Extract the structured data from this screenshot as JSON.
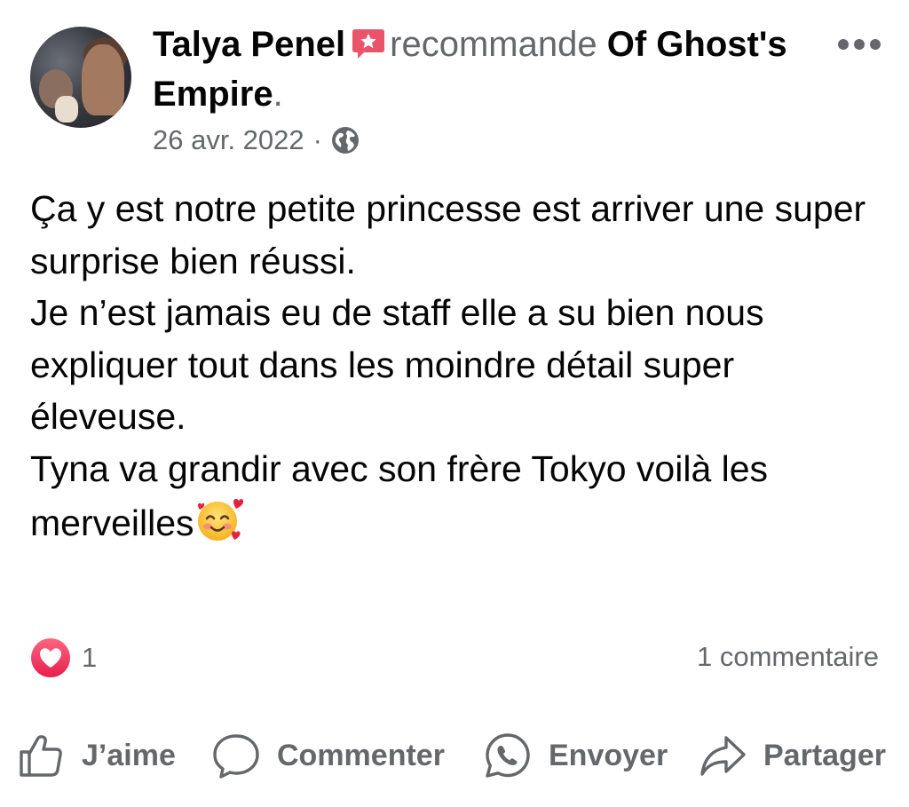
{
  "header": {
    "author": "Talya Penel",
    "verb": "recommande",
    "page": "Of Ghost's Empire",
    "punct": ".",
    "date": "26 avr. 2022",
    "separator": "·",
    "privacy_icon": "globe-icon",
    "recommend_icon": "recommend-star-icon",
    "more_icon": "more-horizontal-icon"
  },
  "post": {
    "paragraphs": [
      "Ça y est notre petite princesse est arriver une super surprise bien réussi.",
      "Je n’est jamais eu de staff elle a su bien nous expliquer tout dans les moindre détail super éleveuse.",
      "Tyna va grandir avec son frère Tokyo voilà les merveilles"
    ],
    "emoji_icon": "smiling-face-with-hearts-emoji"
  },
  "stats": {
    "reaction_icon": "heart-reaction-icon",
    "reaction_count": "1",
    "comments": "1 commentaire"
  },
  "actions": {
    "like": "J’aime",
    "comment": "Commenter",
    "send": "Envoyer",
    "share": "Partager"
  },
  "colors": {
    "text": "#050505",
    "secondary": "#65676b",
    "badge_pink": "#e9546b",
    "heart_gradient_top": "#ff6680",
    "heart_gradient_bottom": "#e61e4d"
  }
}
